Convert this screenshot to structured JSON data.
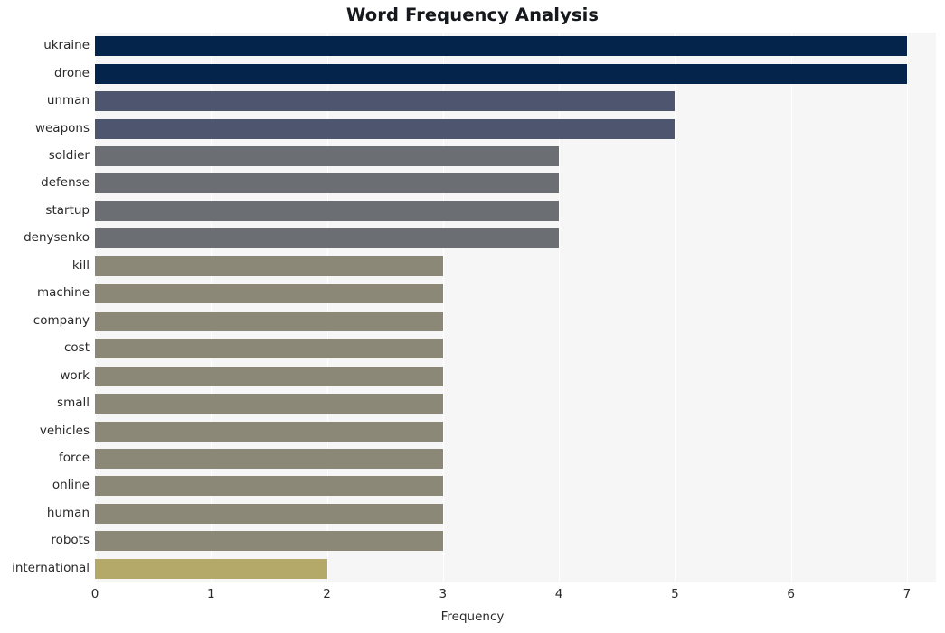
{
  "chart_data": {
    "type": "bar",
    "orientation": "horizontal",
    "title": "Word Frequency Analysis",
    "xlabel": "Frequency",
    "ylabel": "",
    "xlim": [
      0,
      7.25
    ],
    "xticks": [
      0,
      1,
      2,
      3,
      4,
      5,
      6,
      7
    ],
    "xtick_labels": [
      "0",
      "1",
      "2",
      "3",
      "4",
      "5",
      "6",
      "7"
    ],
    "grid": true,
    "grid_axis": "x",
    "legend": false,
    "categories": [
      "ukraine",
      "drone",
      "unman",
      "weapons",
      "soldier",
      "defense",
      "startup",
      "denysenko",
      "kill",
      "machine",
      "company",
      "cost",
      "work",
      "small",
      "vehicles",
      "force",
      "online",
      "human",
      "robots",
      "international"
    ],
    "values": [
      7,
      7,
      5,
      5,
      4,
      4,
      4,
      4,
      3,
      3,
      3,
      3,
      3,
      3,
      3,
      3,
      3,
      3,
      3,
      2
    ],
    "bar_colors": [
      "#04244b",
      "#04244b",
      "#4d556f",
      "#4d556f",
      "#6b6e72",
      "#6b6e72",
      "#6b6e72",
      "#6b6e72",
      "#8c8878",
      "#8c8878",
      "#8c8878",
      "#8c8878",
      "#8c8878",
      "#8c8878",
      "#8c8878",
      "#8c8878",
      "#8c8878",
      "#8c8878",
      "#8c8878",
      "#b5a969"
    ],
    "plot_background": "#f6f6f6",
    "figure_background": "#ffffff",
    "gridline_color": "#ffffff",
    "text_color": "#2a2a2a",
    "title_color": "#15181c"
  }
}
